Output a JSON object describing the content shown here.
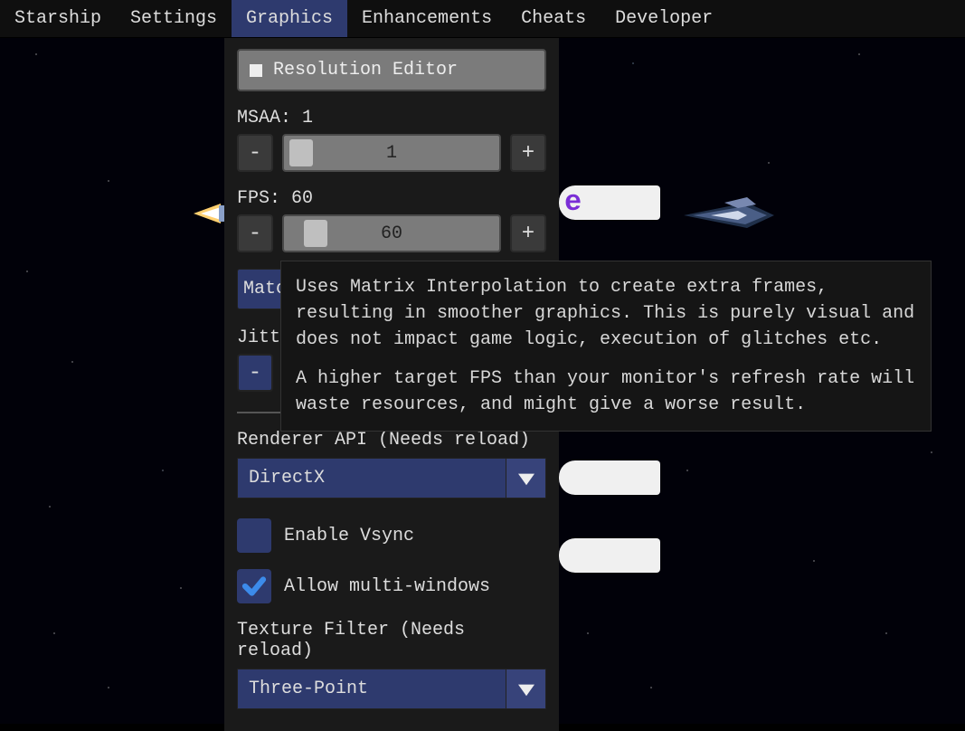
{
  "menubar": {
    "items": [
      "Starship",
      "Settings",
      "Graphics",
      "Enhancements",
      "Cheats",
      "Developer"
    ],
    "active_index": 2
  },
  "panel": {
    "resolution_editor_label": "Resolution Editor",
    "msaa_label": "MSAA: 1",
    "msaa_value": "1",
    "minus": "-",
    "plus": "+",
    "fps_label": "FPS: 60",
    "fps_value": "60",
    "match_label": "Matc",
    "jitter_label": "Jitte",
    "renderer_label": "Renderer API (Needs reload)",
    "renderer_value": "DirectX",
    "vsync_label": "Enable Vsync",
    "vsync_checked": false,
    "multiwin_label": "Allow multi-windows",
    "multiwin_checked": true,
    "texfilter_label": "Texture Filter (Needs reload)",
    "texfilter_value": "Three-Point"
  },
  "tooltip": {
    "p1": "Uses Matrix Interpolation to create extra frames, resulting in smoother graphics. This is purely visual and does not impact game logic, execution of glitches etc.",
    "p2": "A higher target FPS than your monitor's refresh rate will waste resources, and might give a worse result."
  }
}
